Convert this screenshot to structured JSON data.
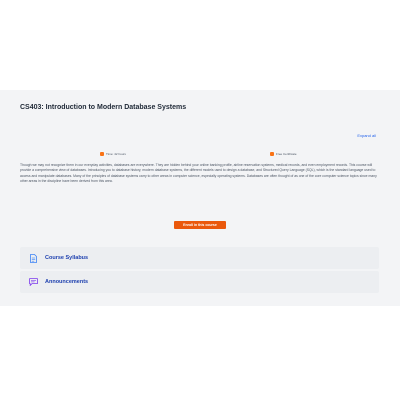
{
  "course": {
    "title": "CS403: Introduction to Modern Database Systems",
    "expand_all_label": "Expand all",
    "meta": [
      {
        "icon": "clock-icon",
        "text": "Time: 42 hours"
      },
      {
        "icon": "certificate-icon",
        "text": "Free Certificate"
      }
    ],
    "description": "Though we may not recognize them in our everyday activities, databases are everywhere. They are hidden behind your online banking profile, airline reservation systems, medical records, and even employment records. This course will provide a comprehensive view of databases. Introducing you to database history, modern database systems, the different models used to design a database, and Structured Query Language (SQL), which is the standard language used to access and manipulate databases. Many of the principles of database systems carry to other areas in computer science, especially operating systems. Databases are often thought of as one of the core computer science topics since many other areas in the discipline have been derived from this area.",
    "enroll_label": "Enroll in this course",
    "sections": [
      {
        "label": "Course Syllabus",
        "icon": "document-icon"
      },
      {
        "label": "Announcements",
        "icon": "message-icon"
      }
    ]
  },
  "colors": {
    "accent": "#ea580c",
    "link": "#2563eb",
    "section_label": "#1e40af",
    "band_bg": "#f3f4f6"
  }
}
